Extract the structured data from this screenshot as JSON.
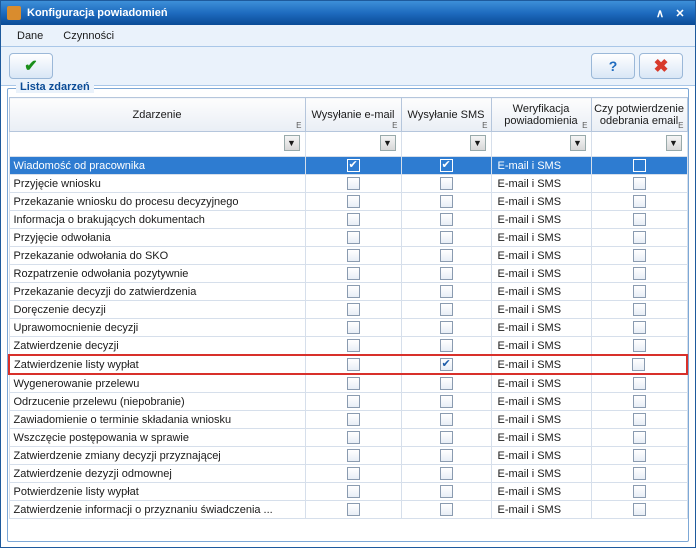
{
  "window": {
    "title": "Konfiguracja powiadomień"
  },
  "menu": {
    "dane": "Dane",
    "czynnosci": "Czynności"
  },
  "group": {
    "legend": "Lista zdarzeń"
  },
  "columns": {
    "event": "Zdarzenie",
    "email": "Wysyłanie e-mail",
    "sms": "Wysyłanie SMS",
    "verify": "Weryfikacja powiadomienia",
    "confirm": "Czy potwierdzenie odebrania email"
  },
  "verify_text": "E-mail i SMS",
  "rows": [
    {
      "name": "Wiadomość od pracownika",
      "email": true,
      "sms": true,
      "confirm": false,
      "selected": true
    },
    {
      "name": "Przyjęcie wniosku",
      "email": false,
      "sms": false,
      "confirm": false
    },
    {
      "name": "Przekazanie wniosku do procesu decyzyjnego",
      "email": false,
      "sms": false,
      "confirm": false
    },
    {
      "name": "Informacja o brakujących dokumentach",
      "email": false,
      "sms": false,
      "confirm": false
    },
    {
      "name": "Przyjęcie odwołania",
      "email": false,
      "sms": false,
      "confirm": false
    },
    {
      "name": "Przekazanie odwołania do SKO",
      "email": false,
      "sms": false,
      "confirm": false
    },
    {
      "name": "Rozpatrzenie odwołania pozytywnie",
      "email": false,
      "sms": false,
      "confirm": false
    },
    {
      "name": "Przekazanie decyzji do zatwierdzenia",
      "email": false,
      "sms": false,
      "confirm": false
    },
    {
      "name": "Doręczenie decyzji",
      "email": false,
      "sms": false,
      "confirm": false
    },
    {
      "name": "Uprawomocnienie decyzji",
      "email": false,
      "sms": false,
      "confirm": false
    },
    {
      "name": "Zatwierdzenie decyzji",
      "email": false,
      "sms": false,
      "confirm": false
    },
    {
      "name": "Zatwierdzenie listy wypłat",
      "email": false,
      "sms": true,
      "confirm": false,
      "highlight": true
    },
    {
      "name": "Wygenerowanie przelewu",
      "email": false,
      "sms": false,
      "confirm": false
    },
    {
      "name": "Odrzucenie przelewu (niepobranie)",
      "email": false,
      "sms": false,
      "confirm": false
    },
    {
      "name": "Zawiadomienie o terminie składania wniosku",
      "email": false,
      "sms": false,
      "confirm": false
    },
    {
      "name": "Wszczęcie postępowania w sprawie",
      "email": false,
      "sms": false,
      "confirm": false
    },
    {
      "name": "Zatwierdzenie zmiany decyzji przyznającej",
      "email": false,
      "sms": false,
      "confirm": false
    },
    {
      "name": "Zatwierdzenie dezyzji odmownej",
      "email": false,
      "sms": false,
      "confirm": false
    },
    {
      "name": "Potwierdzenie listy wypłat",
      "email": false,
      "sms": false,
      "confirm": false
    },
    {
      "name": "Zatwierdzenie informacji o przyznaniu świadczenia ...",
      "email": false,
      "sms": false,
      "confirm": false
    }
  ]
}
